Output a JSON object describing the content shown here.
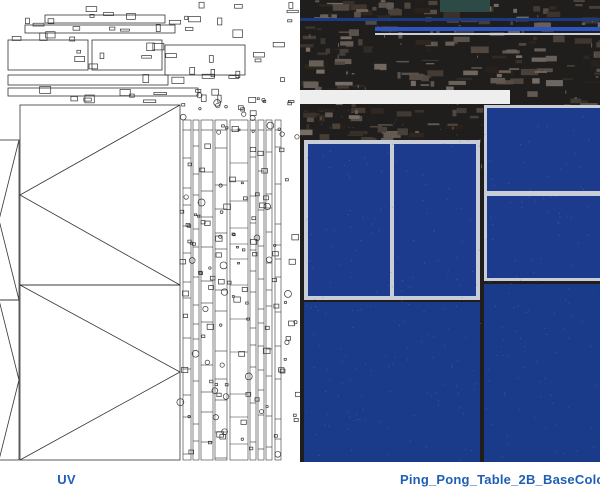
{
  "captions": {
    "uv": "UV",
    "texture": "Ping_Pong_Table_2B_BaseColo"
  },
  "colors": {
    "caption": "#1f5fb5",
    "table_blue": "#1c3b8c",
    "table_line": "#c9cdd6",
    "wireframe_line": "#333333",
    "dark_texture": "#1b1b1b"
  }
}
